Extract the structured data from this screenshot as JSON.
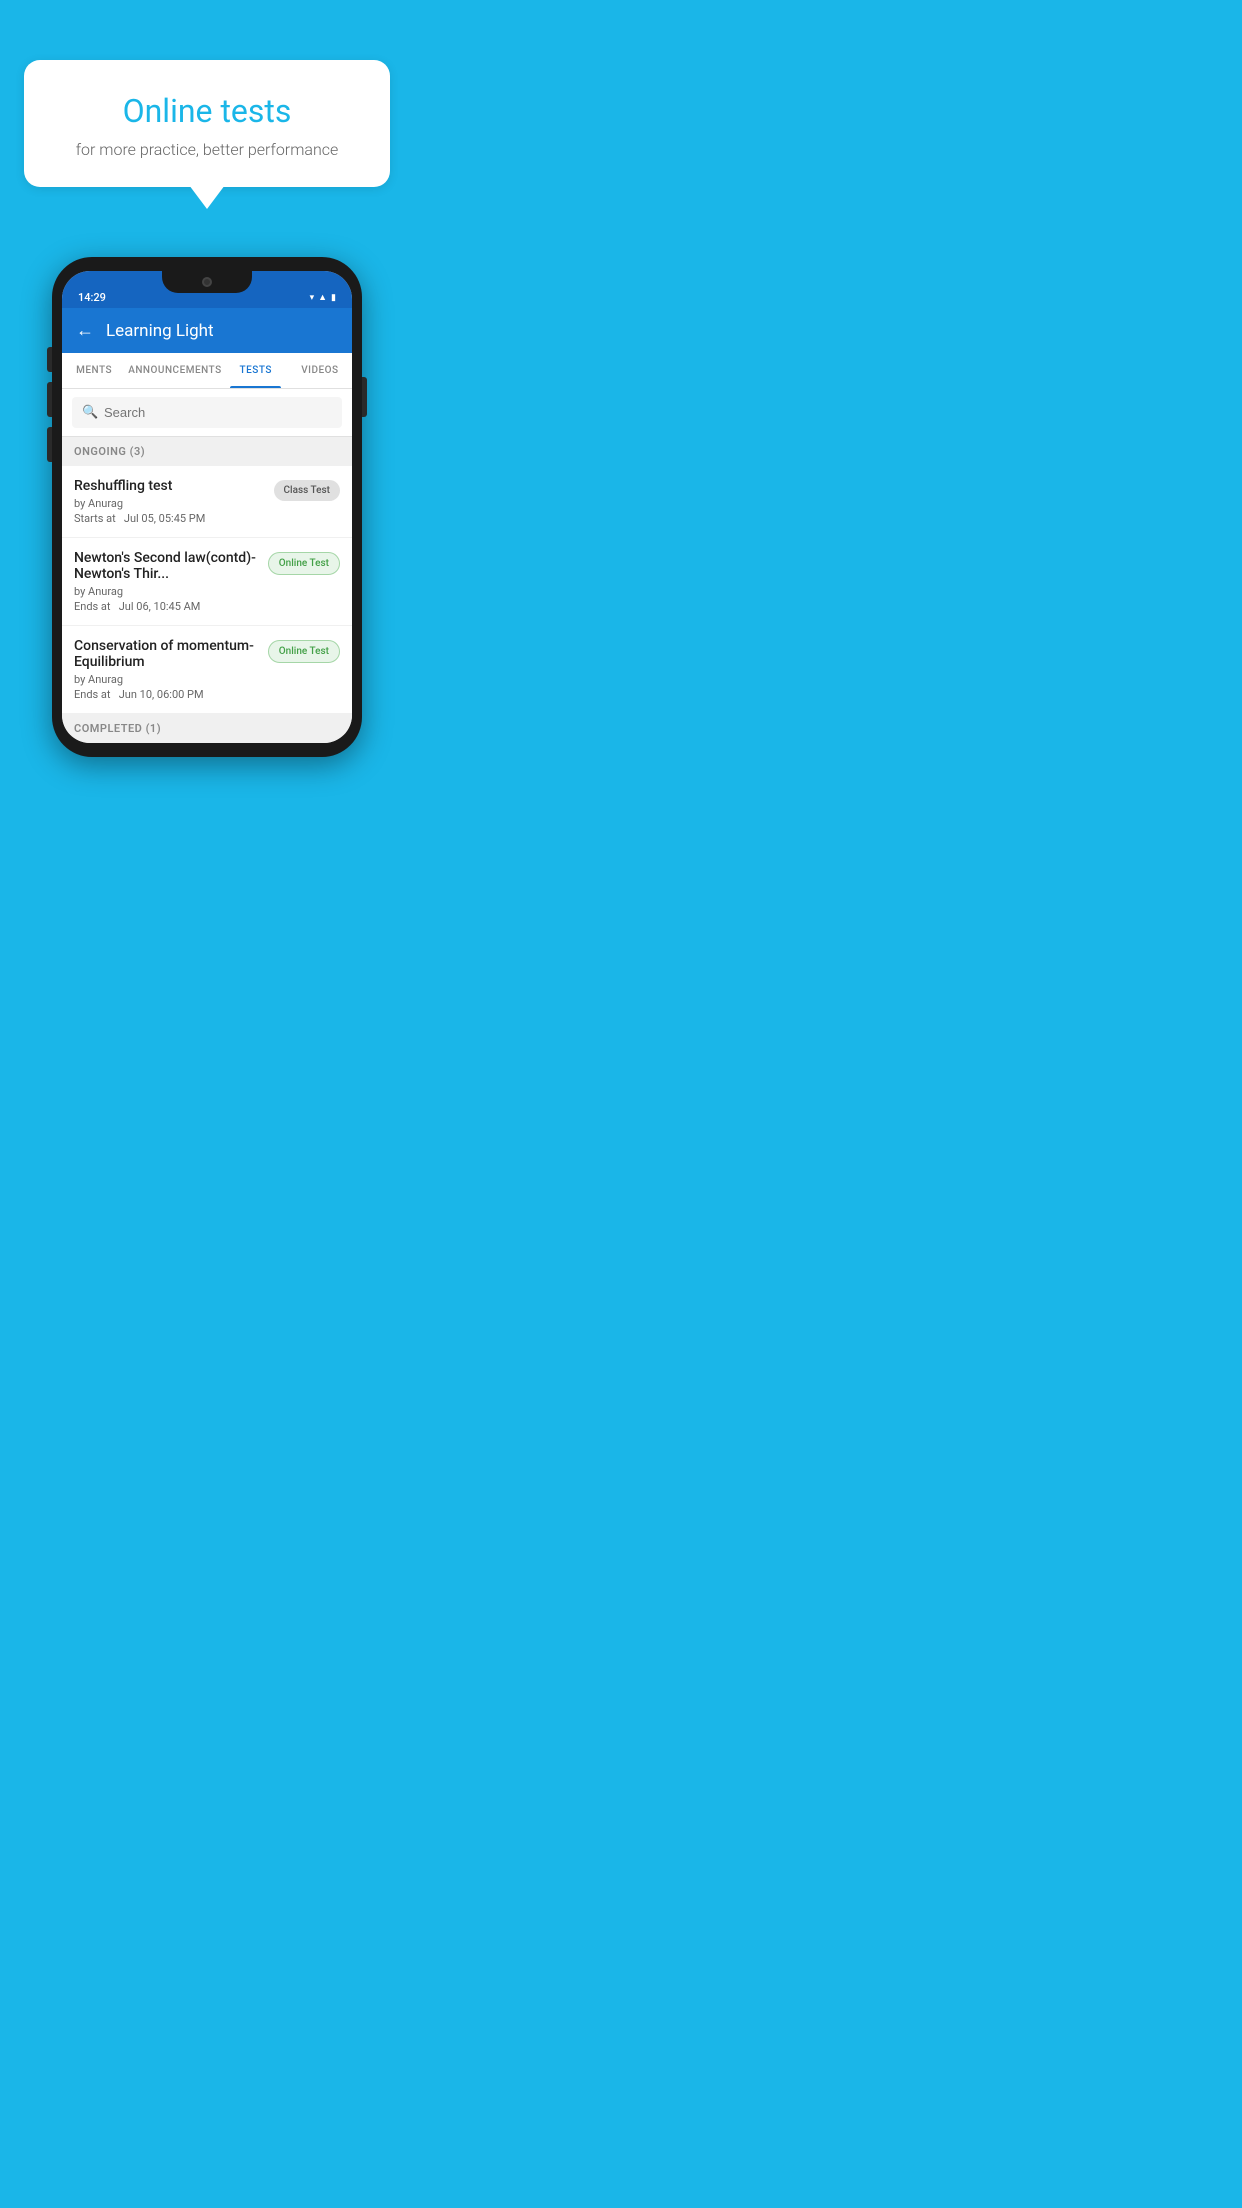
{
  "background_color": "#1ab6e8",
  "speech_bubble": {
    "title": "Online tests",
    "subtitle": "for more practice, better performance"
  },
  "phone": {
    "status_bar": {
      "time": "14:29",
      "icons": [
        "wifi",
        "signal",
        "battery"
      ]
    },
    "header": {
      "title": "Learning Light",
      "back_label": "←"
    },
    "tabs": [
      {
        "label": "MENTS",
        "active": false
      },
      {
        "label": "ANNOUNCEMENTS",
        "active": false
      },
      {
        "label": "TESTS",
        "active": true
      },
      {
        "label": "VIDEOS",
        "active": false
      }
    ],
    "search": {
      "placeholder": "Search"
    },
    "ongoing_section": {
      "label": "ONGOING (3)",
      "tests": [
        {
          "name": "Reshuffling test",
          "author": "by Anurag",
          "time_label": "Starts at",
          "time": "Jul 05, 05:45 PM",
          "badge": "Class Test",
          "badge_type": "class"
        },
        {
          "name": "Newton's Second law(contd)-Newton's Thir...",
          "author": "by Anurag",
          "time_label": "Ends at",
          "time": "Jul 06, 10:45 AM",
          "badge": "Online Test",
          "badge_type": "online"
        },
        {
          "name": "Conservation of momentum-Equilibrium",
          "author": "by Anurag",
          "time_label": "Ends at",
          "time": "Jun 10, 06:00 PM",
          "badge": "Online Test",
          "badge_type": "online"
        }
      ]
    },
    "completed_section": {
      "label": "COMPLETED (1)"
    }
  }
}
